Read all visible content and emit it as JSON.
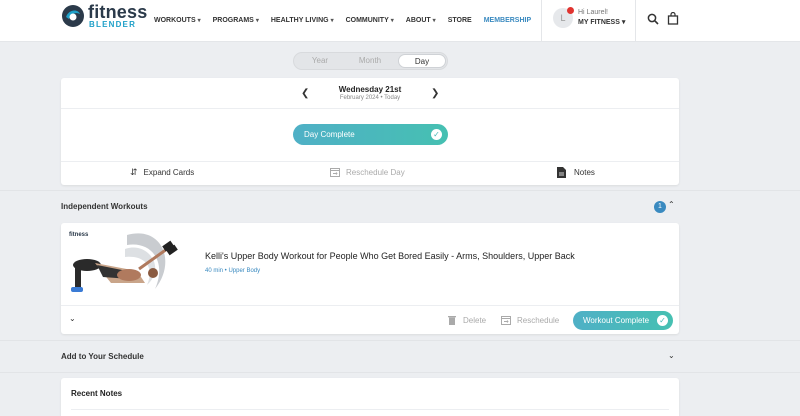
{
  "header": {
    "logo": {
      "word1": "fitness",
      "word2": "BLENDER"
    },
    "nav": [
      {
        "label": "WORKOUTS",
        "caret": "▾"
      },
      {
        "label": "PROGRAMS",
        "caret": "▾"
      },
      {
        "label": "HEALTHY LIVING",
        "caret": "▾"
      },
      {
        "label": "COMMUNITY",
        "caret": "▾"
      },
      {
        "label": "ABOUT",
        "caret": "▾"
      },
      {
        "label": "STORE",
        "caret": ""
      },
      {
        "label": "MEMBERSHIP",
        "caret": ""
      }
    ],
    "user": {
      "initial": "L",
      "greeting": "Hi Laurel!",
      "menu_label": "MY FITNESS ▾"
    }
  },
  "view_toggle": {
    "year": "Year",
    "month": "Month",
    "day": "Day",
    "selected": "Day"
  },
  "day_card": {
    "date_main": "Wednesday 21st",
    "date_sub": "February 2024 • Today",
    "prev_icon": "chevron-left-icon",
    "next_icon": "chevron-right-icon",
    "complete_label": "Day Complete",
    "actions": {
      "expand": "Expand Cards",
      "reschedule": "Reschedule Day",
      "notes": "Notes"
    }
  },
  "independent": {
    "title": "Independent Workouts",
    "count": "1",
    "workout": {
      "thumb_brand": "fitness",
      "title": "Kelli's Upper Body Workout for People Who Get Bored Easily - Arms, Shoulders, Upper Back",
      "meta": "40 min • Upper Body",
      "delete_label": "Delete",
      "reschedule_label": "Reschedule",
      "complete_label": "Workout Complete"
    }
  },
  "add_schedule": {
    "title": "Add to Your Schedule"
  },
  "recent_notes": {
    "title": "Recent Notes"
  },
  "colors": {
    "accent_gradient_start": "#4fb0c6",
    "accent_gradient_end": "#46c0b2",
    "link": "#3a8ac0",
    "notification": "#e0332f"
  }
}
